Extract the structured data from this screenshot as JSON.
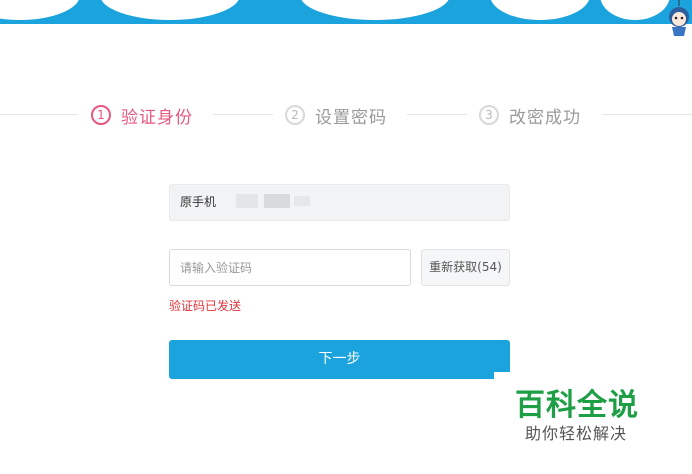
{
  "colors": {
    "brand_blue": "#1aa3dd",
    "active_pink": "#e8577d",
    "error_red": "#e0333a",
    "watermark_green": "#1e9e45"
  },
  "steps": [
    {
      "number": "1",
      "label": "验证身份",
      "state": "active"
    },
    {
      "number": "2",
      "label": "设置密码",
      "state": "pending"
    },
    {
      "number": "3",
      "label": "改密成功",
      "state": "pending"
    }
  ],
  "form": {
    "phone_label": "原手机",
    "code_placeholder": "请输入验证码",
    "code_value": "",
    "resend_label": "重新获取(54)",
    "status_message": "验证码已发送",
    "next_label": "下一步"
  },
  "watermark": {
    "title": "百科全说",
    "subtitle": "助你轻松解决"
  }
}
